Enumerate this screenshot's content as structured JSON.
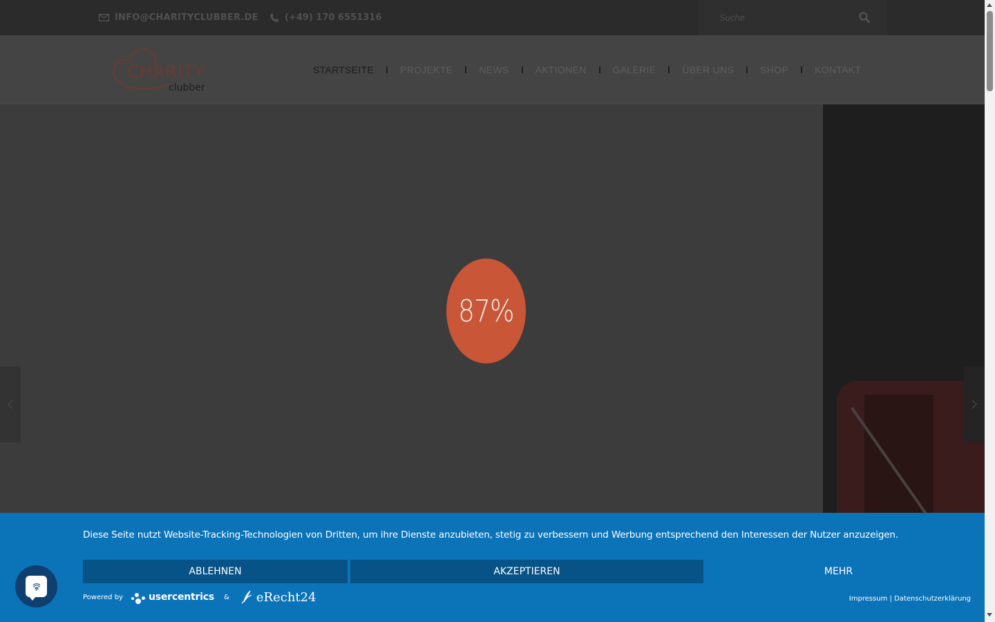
{
  "topbar": {
    "email": "INFO@CHARITYCLUBBER.DE",
    "phone": "(+49) 170 6551316",
    "search_placeholder": "Suche",
    "icons": {
      "email": "envelope-icon",
      "phone": "phone-icon",
      "search": "search-icon"
    }
  },
  "header": {
    "logo": {
      "main": "CHARITY",
      "sub": "clubber"
    },
    "nav": [
      {
        "label": "STARTSEITE",
        "active": true
      },
      {
        "label": "PROJEKTE"
      },
      {
        "label": "NEWS"
      },
      {
        "label": "AKTIONEN"
      },
      {
        "label": "GALERIE"
      },
      {
        "label": "ÜBER UNS"
      },
      {
        "label": "SHOP"
      },
      {
        "label": "KONTAKT"
      }
    ]
  },
  "hero": {
    "loader_progress": "87%",
    "loader_color": "#c85637"
  },
  "cookie": {
    "message": "Diese Seite nutzt Website-Tracking-Technologien von Dritten, um ihre Dienste anzubieten, stetig zu verbessern und Werbung entsprechend den Interessen der Nutzer anzuzeigen.",
    "reject_label": "ABLEHNEN",
    "accept_label": "AKZEPTIEREN",
    "more_label": "MEHR",
    "powered_by": "Powered by",
    "usercentrics": "usercentrics",
    "ampersand": "&",
    "erecht": "eRecht24",
    "impressum": "Impressum",
    "legal_separator": " | ",
    "datenschutz": "Datenschutzerklärung",
    "banner_color": "#0b73b8",
    "button_color": "#075287"
  }
}
